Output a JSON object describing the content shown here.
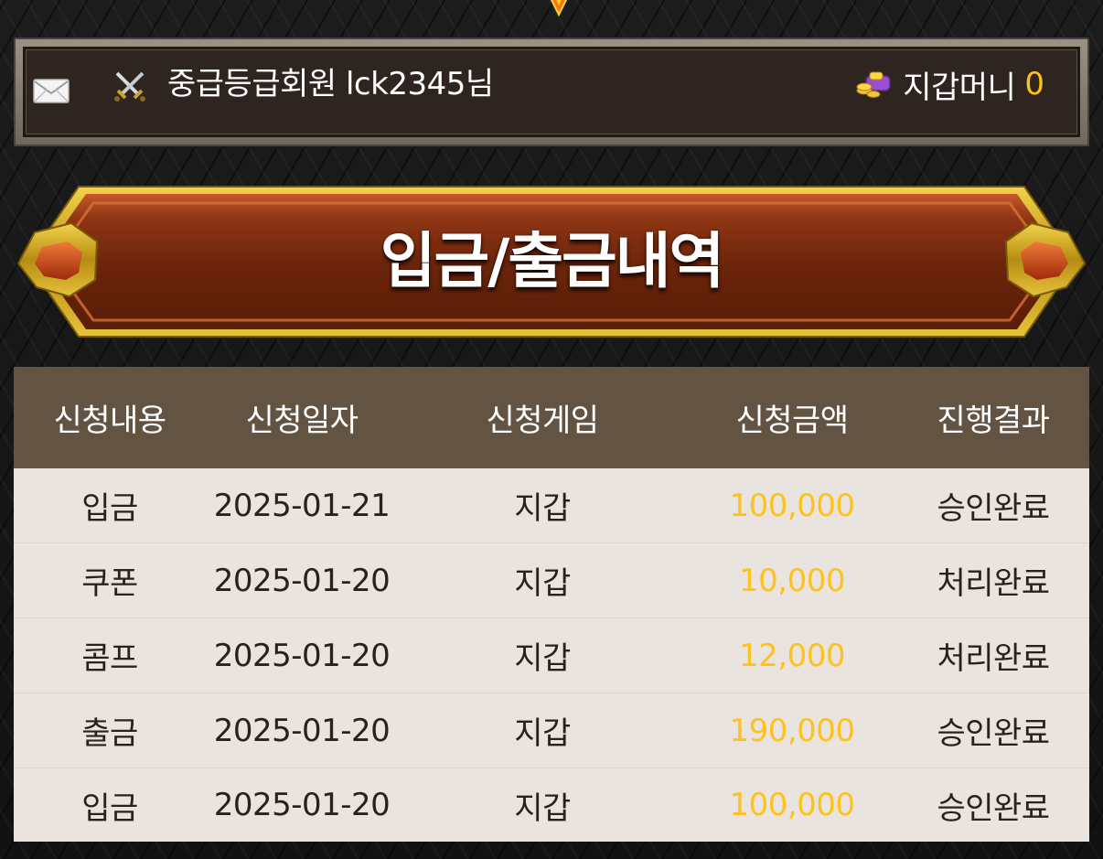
{
  "user": {
    "greeting": "중급등급회원 lck2345님",
    "wallet_label": "지갑머니",
    "wallet_amount": "0"
  },
  "title": "입금/출금내역",
  "table": {
    "headers": [
      "신청내용",
      "신청일자",
      "신청게임",
      "신청금액",
      "진행결과"
    ],
    "rows": [
      {
        "type": "입금",
        "date": "2025-01-21",
        "game": "지갑",
        "amount": "100,000",
        "status": "승인완료"
      },
      {
        "type": "쿠폰",
        "date": "2025-01-20",
        "game": "지갑",
        "amount": "10,000",
        "status": "처리완료"
      },
      {
        "type": "콤프",
        "date": "2025-01-20",
        "game": "지갑",
        "amount": "12,000",
        "status": "처리완료"
      },
      {
        "type": "출금",
        "date": "2025-01-20",
        "game": "지갑",
        "amount": "190,000",
        "status": "승인완료"
      },
      {
        "type": "입금",
        "date": "2025-01-20",
        "game": "지갑",
        "amount": "100,000",
        "status": "승인완료"
      }
    ]
  },
  "icons": {
    "mail": "mail-icon",
    "rank": "crossed-swords-icon",
    "wallet": "wallet-icon",
    "top": "gem-icon"
  },
  "colors": {
    "accent_amount": "#ffc21a",
    "header_bg": "#625343",
    "row_bg": "#e9e4df",
    "banner_red": "#7a2a10",
    "banner_gold": "#d7b11e"
  }
}
